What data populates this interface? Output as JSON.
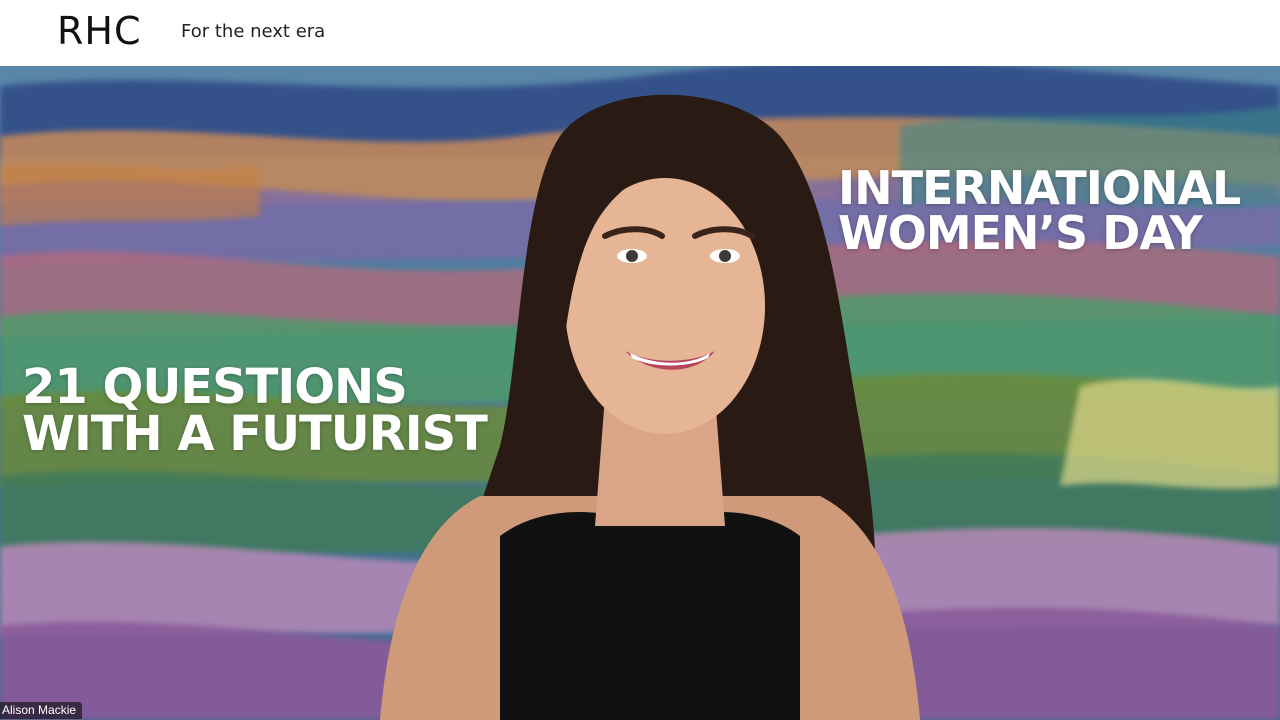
{
  "header": {
    "logo_text": "RHC",
    "tagline": "For the next era"
  },
  "video": {
    "headline_right": {
      "line1": "INTERNATIONAL",
      "line2": "WOMEN’S DAY"
    },
    "headline_left": {
      "line1": "21 QUESTIONS",
      "line2": "WITH A FUTURIST"
    },
    "participant_name": "Alison Mackie"
  },
  "colors": {
    "text_overlay": "#ffffff",
    "header_background": "#ffffff",
    "logo": "#111111"
  }
}
